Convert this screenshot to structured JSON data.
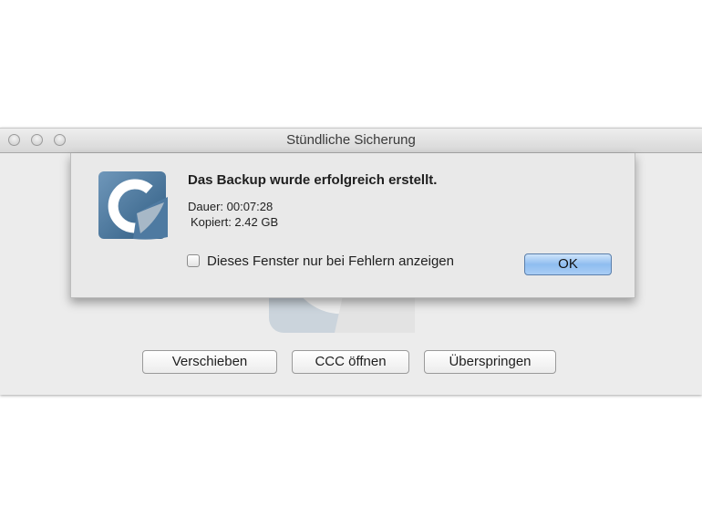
{
  "window": {
    "title": "Stündliche Sicherung"
  },
  "dialog": {
    "headline": "Das Backup wurde erfolgreich erstellt.",
    "duration": "Dauer: 00:07:28",
    "copied": "Kopiert: 2.42 GB",
    "checkbox_label": "Dieses Fenster nur bei Fehlern anzeigen",
    "checkbox_checked": false,
    "ok_label": "OK",
    "app_icon": "ccc-logo-icon",
    "accent_color": "#3d6d95"
  },
  "buttons": {
    "move_label": "Verschieben",
    "open_label": "CCC öffnen",
    "skip_label": "Überspringen"
  },
  "colors": {
    "ok_button": "#9ec6f2",
    "window_bg": "#ececec"
  }
}
